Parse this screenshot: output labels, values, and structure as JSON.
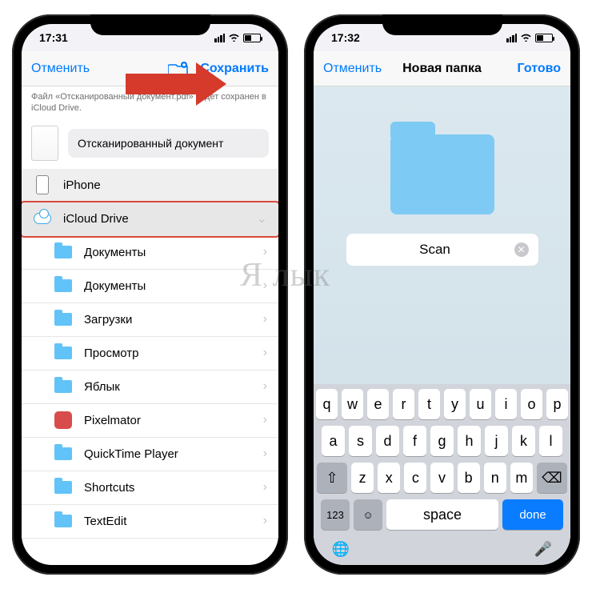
{
  "watermark": "Я лык",
  "left": {
    "status": {
      "time": "17:31"
    },
    "nav": {
      "cancel": "Отменить",
      "save": "Сохранить"
    },
    "hint": "Файл «Отсканированный документ.pdf» будет сохранен в iCloud Drive.",
    "doc_name": "Отсканированный документ",
    "locations": {
      "iphone": "iPhone",
      "icloud": "iCloud Drive"
    },
    "folders": [
      "Документы",
      "Документы",
      "Загрузки",
      "Просмотр",
      "Яблык",
      "Pixelmator",
      "QuickTime Player",
      "Shortcuts",
      "TextEdit"
    ]
  },
  "right": {
    "status": {
      "time": "17:32"
    },
    "nav": {
      "cancel": "Отменить",
      "title": "Новая папка",
      "done": "Готово"
    },
    "folder_name": "Scan",
    "keyboard": {
      "row1": [
        "q",
        "w",
        "e",
        "r",
        "t",
        "y",
        "u",
        "i",
        "o",
        "p"
      ],
      "row2": [
        "a",
        "s",
        "d",
        "f",
        "g",
        "h",
        "j",
        "k",
        "l"
      ],
      "row3": [
        "z",
        "x",
        "c",
        "v",
        "b",
        "n",
        "m"
      ],
      "numkey": "123",
      "space": "space",
      "done": "done"
    }
  }
}
